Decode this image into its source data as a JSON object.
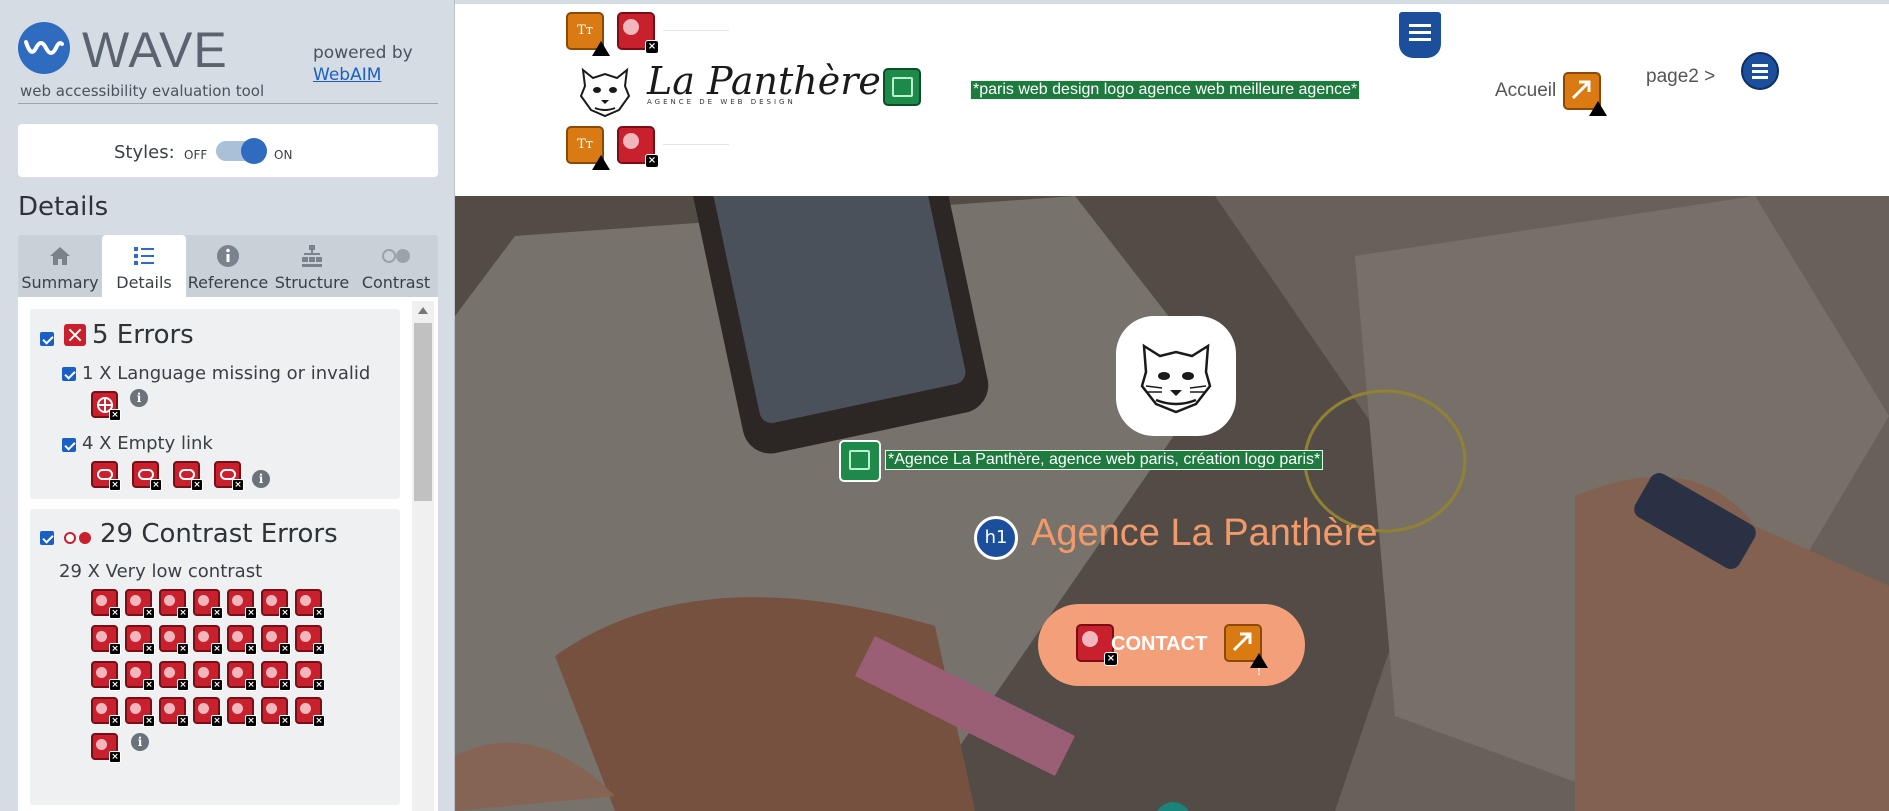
{
  "wave": {
    "brand_word": "WAVE",
    "tagline": "web accessibility evaluation tool",
    "powered_by": "powered by",
    "webaim_link": "WebAIM",
    "styles_label": "Styles:",
    "toggle_off": "OFF",
    "toggle_on": "ON",
    "styles_enabled": true,
    "details_title": "Details",
    "tabs": [
      {
        "label": "Summary",
        "icon": "home-icon",
        "active": false
      },
      {
        "label": "Details",
        "icon": "list-icon",
        "active": true
      },
      {
        "label": "Reference",
        "icon": "info-icon",
        "active": false
      },
      {
        "label": "Structure",
        "icon": "hierarchy-icon",
        "active": false
      },
      {
        "label": "Contrast",
        "icon": "contrast-icon",
        "active": false
      }
    ],
    "errors": {
      "heading": "5 Errors",
      "items": [
        {
          "label": "1 X Language missing or invalid",
          "icon": "language-error-icon",
          "count": 1
        },
        {
          "label": "4 X Empty link",
          "icon": "empty-link-icon",
          "count": 4
        }
      ]
    },
    "contrast_errors": {
      "heading": "29 Contrast Errors",
      "items": [
        {
          "label": "29 X Very low contrast",
          "icon": "contrast-error-icon",
          "count": 29
        }
      ]
    },
    "colors": {
      "accent": "#2f6bbf",
      "error": "#c8202d",
      "alert": "#d97a12",
      "feature": "#1e8a4a",
      "structure": "#1c4f9b"
    }
  },
  "site": {
    "logo_title": "La Panthère",
    "logo_subtitle": "AGENCE DE WEB DESIGN",
    "header_logo_alt": "*paris web design logo agence web meilleure agence*",
    "nav": {
      "home": "Accueil",
      "page2": "page2 >"
    },
    "hero_logo_alt": "*Agence La Panthère, agence web paris, création logo paris*",
    "h1_badge": "h1",
    "hero_title": "Agence La Panthère",
    "contact_button": "CONTACT",
    "text_icon_label": "Tт"
  }
}
